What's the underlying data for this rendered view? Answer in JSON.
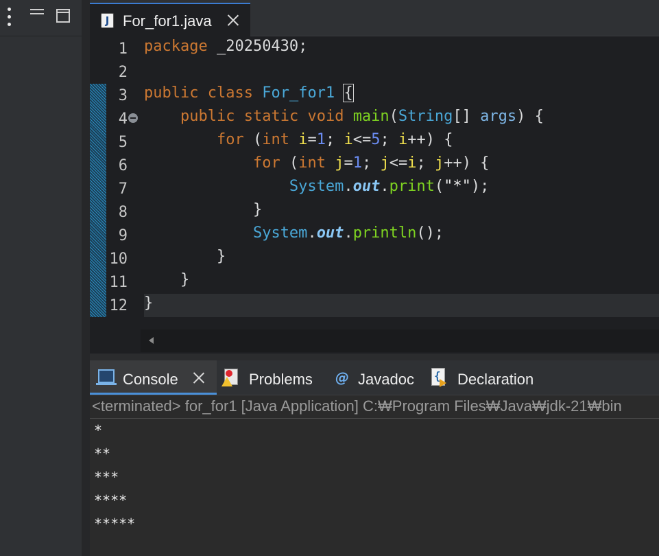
{
  "left_panel": {
    "view_menu_icon": "vertical-dots-icon",
    "minimize_icon": "minimize-icon",
    "maximize_icon": "maximize-icon"
  },
  "editor": {
    "tab": {
      "label": "For_for1.java",
      "icon": "java-file-icon",
      "icon_glyph": "J"
    },
    "line_numbers": [
      "1",
      "2",
      "3",
      "4",
      "5",
      "6",
      "7",
      "8",
      "9",
      "10",
      "11",
      "12"
    ],
    "lines": [
      [
        {
          "t": "package",
          "c": "kw"
        },
        {
          "t": " _20250430;",
          "c": ""
        }
      ],
      [],
      [
        {
          "t": "public",
          "c": "kw"
        },
        {
          "t": " ",
          "c": ""
        },
        {
          "t": "class",
          "c": "kw"
        },
        {
          "t": " ",
          "c": ""
        },
        {
          "t": "For_for1",
          "c": "cls"
        },
        {
          "t": " ",
          "c": ""
        },
        {
          "t": "{",
          "c": "brk-box"
        }
      ],
      [
        {
          "t": "    ",
          "c": ""
        },
        {
          "t": "public",
          "c": "kw"
        },
        {
          "t": " ",
          "c": ""
        },
        {
          "t": "static",
          "c": "kw"
        },
        {
          "t": " ",
          "c": ""
        },
        {
          "t": "void",
          "c": "kw"
        },
        {
          "t": " ",
          "c": ""
        },
        {
          "t": "main",
          "c": "mth"
        },
        {
          "t": "(",
          "c": ""
        },
        {
          "t": "String",
          "c": "cls"
        },
        {
          "t": "[] ",
          "c": ""
        },
        {
          "t": "args",
          "c": "prm"
        },
        {
          "t": ") {",
          "c": ""
        }
      ],
      [
        {
          "t": "        ",
          "c": ""
        },
        {
          "t": "for",
          "c": "kw"
        },
        {
          "t": " (",
          "c": ""
        },
        {
          "t": "int",
          "c": "kw"
        },
        {
          "t": " ",
          "c": ""
        },
        {
          "t": "i",
          "c": "var"
        },
        {
          "t": "=",
          "c": ""
        },
        {
          "t": "1",
          "c": "num"
        },
        {
          "t": "; ",
          "c": ""
        },
        {
          "t": "i",
          "c": "var"
        },
        {
          "t": "<=",
          "c": ""
        },
        {
          "t": "5",
          "c": "num"
        },
        {
          "t": "; ",
          "c": ""
        },
        {
          "t": "i",
          "c": "var"
        },
        {
          "t": "++) {",
          "c": ""
        }
      ],
      [
        {
          "t": "            ",
          "c": ""
        },
        {
          "t": "for",
          "c": "kw"
        },
        {
          "t": " (",
          "c": ""
        },
        {
          "t": "int",
          "c": "kw"
        },
        {
          "t": " ",
          "c": ""
        },
        {
          "t": "j",
          "c": "var"
        },
        {
          "t": "=",
          "c": ""
        },
        {
          "t": "1",
          "c": "num"
        },
        {
          "t": "; ",
          "c": ""
        },
        {
          "t": "j",
          "c": "var"
        },
        {
          "t": "<=",
          "c": ""
        },
        {
          "t": "i",
          "c": "var"
        },
        {
          "t": "; ",
          "c": ""
        },
        {
          "t": "j",
          "c": "var"
        },
        {
          "t": "++) {",
          "c": ""
        }
      ],
      [
        {
          "t": "                ",
          "c": ""
        },
        {
          "t": "System",
          "c": "cls"
        },
        {
          "t": ".",
          "c": ""
        },
        {
          "t": "out",
          "c": "fld"
        },
        {
          "t": ".",
          "c": ""
        },
        {
          "t": "print",
          "c": "mth"
        },
        {
          "t": "(",
          "c": ""
        },
        {
          "t": "\"*\"",
          "c": "str"
        },
        {
          "t": ");",
          "c": ""
        }
      ],
      [
        {
          "t": "            }",
          "c": ""
        }
      ],
      [
        {
          "t": "            ",
          "c": ""
        },
        {
          "t": "System",
          "c": "cls"
        },
        {
          "t": ".",
          "c": ""
        },
        {
          "t": "out",
          "c": "fld"
        },
        {
          "t": ".",
          "c": ""
        },
        {
          "t": "println",
          "c": "mth"
        },
        {
          "t": "();",
          "c": ""
        }
      ],
      [
        {
          "t": "        }",
          "c": ""
        }
      ],
      [
        {
          "t": "    }",
          "c": ""
        }
      ],
      [
        {
          "t": "}",
          "c": ""
        }
      ]
    ]
  },
  "console": {
    "tabs": [
      {
        "label": "Console",
        "icon": "console-icon",
        "active": true
      },
      {
        "label": "Problems",
        "icon": "problems-icon",
        "active": false
      },
      {
        "label": "Javadoc",
        "icon": "javadoc-icon",
        "icon_glyph": "@",
        "active": false
      },
      {
        "label": "Declaration",
        "icon": "declaration-icon",
        "active": false
      }
    ],
    "header": "<terminated> for_for1 [Java Application] C:₩Program Files₩Java₩jdk-21₩bin",
    "output": [
      "*",
      "**",
      "***",
      "****",
      "*****"
    ]
  }
}
